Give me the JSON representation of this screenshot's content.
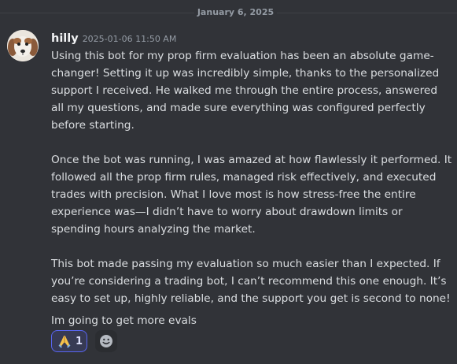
{
  "divider": {
    "date": "January 6, 2025"
  },
  "message": {
    "author": "hilly",
    "timestamp": "2025-01-06 11:50 AM",
    "paragraphs": [
      "Using this bot for my prop firm evaluation has been an absolute game-changer! Setting it up was incredibly simple, thanks to the personalized support I received. He walked me through the entire process, answered all my questions, and made sure everything was configured perfectly before starting.",
      "Once the bot was running, I was amazed at how flawlessly it performed. It followed all the prop firm rules, managed risk effectively, and executed trades with precision. What I love most is how stress-free the entire experience was—I didn’t have to worry about drawdown limits or spending hours analyzing the market.",
      "This bot made passing my evaluation so much easier than I expected. If you’re considering a trading bot, I can’t recommend this one enough. It’s easy to set up, highly reliable, and the support you get is second to none!",
      "Im going to get more evals"
    ],
    "avatar_icon": "dog-avatar"
  },
  "reactions": [
    {
      "emoji": "folded-hands",
      "count": "1",
      "active": true
    }
  ],
  "add_reaction_icon": "smiley-face-icon",
  "colors": {
    "background": "#313338",
    "text": "#dbdee1",
    "muted": "#949ba4",
    "accent": "#5865f2",
    "reaction_bg": "#373a54"
  }
}
